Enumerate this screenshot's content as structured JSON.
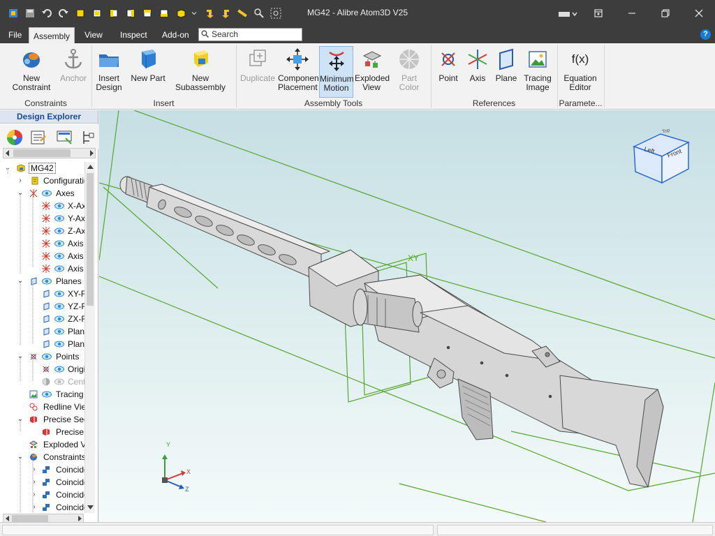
{
  "window": {
    "title": "MG42 - Alibre Atom3D V25"
  },
  "menu": {
    "items": [
      "File",
      "Assembly",
      "View",
      "Inspect",
      "Add-on"
    ],
    "active": "Assembly",
    "search_placeholder": "Search",
    "help": "?"
  },
  "ribbon": {
    "groups": {
      "constraints": "Constraints",
      "insert": "Insert",
      "assembly_tools": "Assembly Tools",
      "references": "References",
      "parameters": "Paramete..."
    },
    "buttons": {
      "new_constraint": "New Constraint",
      "anchor": "Anchor",
      "insert_design_1": "Insert",
      "insert_design_2": "Design",
      "new_part": "New Part",
      "new_subassembly": "New Subassembly",
      "duplicate": "Duplicate",
      "component_placement_1": "Component",
      "component_placement_2": "Placement",
      "minimum_motion_1": "Minimum",
      "minimum_motion_2": "Motion",
      "exploded_view_1": "Exploded",
      "exploded_view_2": "View",
      "part_color": "Part Color",
      "point": "Point",
      "axis": "Axis",
      "plane": "Plane",
      "tracing_image_1": "Tracing",
      "tracing_image_2": "Image",
      "equation_editor_1": "Equation",
      "equation_editor_2": "Editor",
      "fx": "f(x)"
    }
  },
  "explorer": {
    "title": "Design Explorer",
    "tree": [
      {
        "label": "MG42"
      },
      {
        "label": "Configuration"
      },
      {
        "label": "Axes"
      },
      {
        "label": "X-Ax"
      },
      {
        "label": "Y-Ax"
      },
      {
        "label": "Z-Ax"
      },
      {
        "label": "Axis"
      },
      {
        "label": "Axis"
      },
      {
        "label": "Axis"
      },
      {
        "label": "Planes"
      },
      {
        "label": "XY-F"
      },
      {
        "label": "YZ-F"
      },
      {
        "label": "ZX-F"
      },
      {
        "label": "Plan"
      },
      {
        "label": "Plan"
      },
      {
        "label": "Points"
      },
      {
        "label": "Origi"
      },
      {
        "label": "Cent"
      },
      {
        "label": "Tracing"
      },
      {
        "label": "Redline View"
      },
      {
        "label": "Precise Sec"
      },
      {
        "label": "Precise S"
      },
      {
        "label": "Exploded Vi"
      },
      {
        "label": "Constraints"
      },
      {
        "label": "Coincide"
      },
      {
        "label": "Coincide"
      },
      {
        "label": "Coincide"
      },
      {
        "label": "Coincide"
      }
    ]
  },
  "viewport": {
    "plane_label": "XY",
    "viewcube": {
      "top": "Top",
      "left": "Left",
      "front": "Front"
    },
    "triad": {
      "x": "X",
      "y": "Y",
      "z": "Z"
    },
    "colors": {
      "plane": "#4ea32a",
      "model": "#d7d7d7",
      "model_edge": "#4a4a4a"
    }
  }
}
